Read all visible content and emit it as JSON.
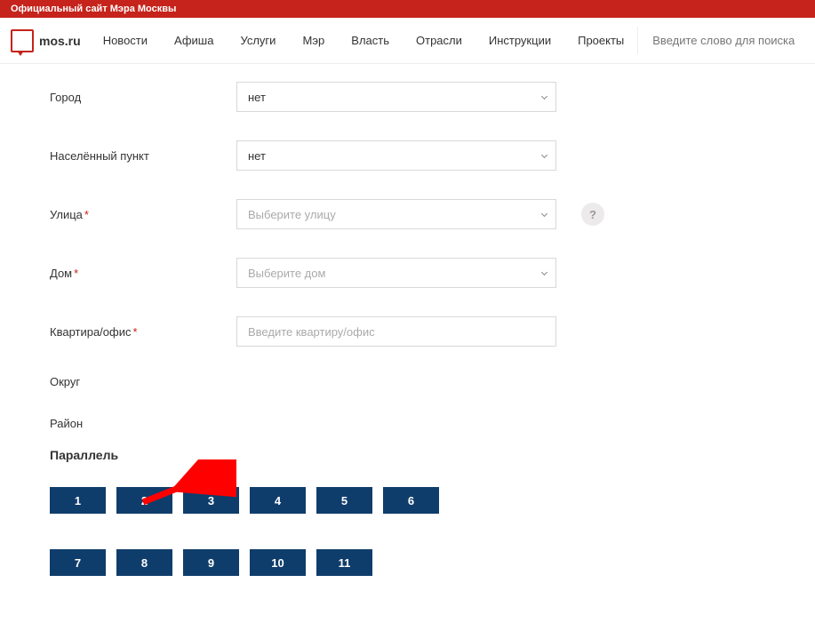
{
  "topbar": {
    "text": "Официальный сайт Мэра Москвы"
  },
  "logo": {
    "text": "mos.ru"
  },
  "nav": {
    "items": [
      "Новости",
      "Афиша",
      "Услуги",
      "Мэр",
      "Власть",
      "Отрасли",
      "Инструкции",
      "Проекты"
    ]
  },
  "search": {
    "placeholder": "Введите слово для поиска"
  },
  "form": {
    "city": {
      "label": "Город",
      "value": "нет"
    },
    "settlement": {
      "label": "Населённый пункт",
      "value": "нет"
    },
    "street": {
      "label": "Улица",
      "placeholder": "Выберите улицу"
    },
    "house": {
      "label": "Дом",
      "placeholder": "Выберите дом"
    },
    "apartment": {
      "label": "Квартира/офис",
      "placeholder": "Введите квартиру/офис"
    },
    "district": {
      "label": "Округ"
    },
    "region": {
      "label": "Район"
    }
  },
  "parallel": {
    "title": "Параллель",
    "row1": [
      "1",
      "2",
      "3",
      "4",
      "5",
      "6"
    ],
    "row2": [
      "7",
      "8",
      "9",
      "10",
      "11"
    ]
  },
  "help": {
    "label": "?"
  }
}
